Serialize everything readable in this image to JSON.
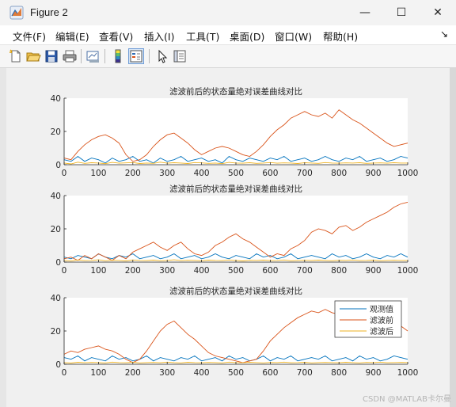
{
  "window": {
    "title": "Figure 2",
    "minimize_glyph": "—",
    "maximize_glyph": "☐",
    "close_glyph": "✕"
  },
  "menu": {
    "items": [
      "文件(F)",
      "编辑(E)",
      "查看(V)",
      "插入(I)",
      "工具(T)",
      "桌面(D)",
      "窗口(W)",
      "帮助(H)"
    ],
    "overflow_glyph": "↘"
  },
  "toolbar": {
    "icons": [
      "new-figure-icon",
      "open-file-icon",
      "save-icon",
      "print-icon",
      "link-plot-icon",
      "insert-colorbar-icon",
      "insert-legend-icon",
      "edit-plot-icon",
      "property-inspector-icon"
    ]
  },
  "watermark": "CSDN @MATLAB卡尔曼",
  "colors": {
    "observed": "#0072BD",
    "before": "#D95319",
    "after": "#EDB120"
  },
  "chart_data": [
    {
      "type": "line",
      "title": "滤波前后的状态量绝对误差曲线对比",
      "xlim": [
        0,
        1000
      ],
      "ylim": [
        0,
        40
      ],
      "xticks": [
        0,
        100,
        200,
        300,
        400,
        500,
        600,
        700,
        800,
        900,
        1000
      ],
      "yticks": [
        0,
        20,
        40
      ],
      "grid": false,
      "x": [
        0,
        20,
        40,
        60,
        80,
        100,
        120,
        140,
        160,
        180,
        200,
        220,
        240,
        260,
        280,
        300,
        320,
        340,
        360,
        380,
        400,
        420,
        440,
        460,
        480,
        500,
        520,
        540,
        560,
        580,
        600,
        620,
        640,
        660,
        680,
        700,
        720,
        740,
        760,
        780,
        800,
        820,
        840,
        860,
        880,
        900,
        920,
        940,
        960,
        980,
        1000
      ],
      "series": [
        {
          "values": [
            3,
            2,
            5,
            2,
            4,
            3,
            1,
            4,
            2,
            3,
            5,
            2,
            3,
            1,
            4,
            2,
            3,
            5,
            2,
            3,
            4,
            2,
            3,
            1,
            5,
            3,
            2,
            4,
            3,
            2,
            4,
            3,
            5,
            2,
            3,
            4,
            2,
            3,
            5,
            3,
            2,
            4,
            3,
            5,
            2,
            3,
            4,
            2,
            3,
            5,
            4
          ]
        },
        {
          "values": [
            4,
            3,
            8,
            12,
            15,
            17,
            18,
            16,
            13,
            6,
            2,
            3,
            6,
            11,
            15,
            18,
            19,
            16,
            13,
            9,
            6,
            8,
            10,
            11,
            10,
            8,
            6,
            5,
            8,
            12,
            17,
            21,
            24,
            28,
            30,
            32,
            30,
            29,
            31,
            28,
            33,
            30,
            27,
            25,
            22,
            19,
            16,
            13,
            11,
            12,
            13
          ]
        },
        {
          "values": [
            1,
            0.5,
            1.5,
            0.8,
            1.2,
            1,
            0.6,
            1.4,
            0.9,
            1.1,
            1.3,
            0.7,
            1,
            0.8,
            1.5,
            0.9,
            1.2,
            1,
            0.7,
            1.3,
            1.1,
            0.8,
            1,
            0.6,
            1.4,
            1,
            0.9,
            1.2,
            0.8,
            1,
            1.3,
            0.9,
            1.1,
            1,
            0.7,
            1.2,
            1,
            0.8,
            1.3,
            1,
            0.9,
            1.1,
            1,
            1.2,
            0.8,
            1,
            1.1,
            0.9,
            1.2,
            1,
            1
          ]
        }
      ]
    },
    {
      "type": "line",
      "title": "滤波前后的状态量绝对误差曲线对比",
      "xlim": [
        0,
        1000
      ],
      "ylim": [
        0,
        40
      ],
      "xticks": [
        0,
        100,
        200,
        300,
        400,
        500,
        600,
        700,
        800,
        900,
        1000
      ],
      "yticks": [
        0,
        20,
        40
      ],
      "grid": false,
      "x": [
        0,
        20,
        40,
        60,
        80,
        100,
        120,
        140,
        160,
        180,
        200,
        220,
        240,
        260,
        280,
        300,
        320,
        340,
        360,
        380,
        400,
        420,
        440,
        460,
        480,
        500,
        520,
        540,
        560,
        580,
        600,
        620,
        640,
        660,
        680,
        700,
        720,
        740,
        760,
        780,
        800,
        820,
        840,
        860,
        880,
        900,
        920,
        940,
        960,
        980,
        1000
      ],
      "series": [
        {
          "values": [
            3,
            2,
            4,
            3,
            2,
            5,
            3,
            2,
            4,
            3,
            5,
            2,
            3,
            4,
            2,
            3,
            5,
            2,
            3,
            4,
            2,
            3,
            5,
            3,
            2,
            4,
            3,
            2,
            5,
            3,
            4,
            2,
            3,
            5,
            2,
            3,
            4,
            3,
            2,
            5,
            3,
            4,
            2,
            3,
            5,
            3,
            2,
            4,
            3,
            5,
            3
          ]
        },
        {
          "values": [
            2,
            3,
            1,
            4,
            2,
            5,
            3,
            1,
            4,
            2,
            6,
            8,
            10,
            12,
            9,
            7,
            10,
            12,
            8,
            5,
            4,
            6,
            10,
            12,
            15,
            17,
            14,
            12,
            9,
            6,
            3,
            5,
            4,
            8,
            10,
            13,
            18,
            20,
            19,
            17,
            21,
            22,
            19,
            21,
            24,
            26,
            28,
            30,
            33,
            35,
            36
          ]
        },
        {
          "values": [
            1,
            0.6,
            1.3,
            0.9,
            1,
            1.4,
            0.8,
            1.1,
            1,
            0.7,
            1.3,
            1,
            0.9,
            1.2,
            0.8,
            1,
            1.4,
            0.9,
            1.1,
            1,
            0.8,
            1.2,
            1,
            0.9,
            1.3,
            1,
            0.7,
            1.1,
            1,
            1.2,
            0.9,
            1,
            1.3,
            0.8,
            1,
            1.1,
            0.9,
            1.2,
            1,
            0.8,
            1.1,
            1,
            1.3,
            0.9,
            1,
            1.2,
            0.8,
            1,
            1.1,
            1,
            1
          ]
        }
      ]
    },
    {
      "type": "line",
      "title": "滤波前后的状态量绝对误差曲线对比",
      "xlim": [
        0,
        1000
      ],
      "ylim": [
        0,
        40
      ],
      "xticks": [
        0,
        100,
        200,
        300,
        400,
        500,
        600,
        700,
        800,
        900,
        1000
      ],
      "yticks": [
        0,
        20,
        40
      ],
      "grid": false,
      "legend": {
        "location": "top-right",
        "entries": [
          "观测值",
          "滤波前",
          "滤波后"
        ]
      },
      "x": [
        0,
        20,
        40,
        60,
        80,
        100,
        120,
        140,
        160,
        180,
        200,
        220,
        240,
        260,
        280,
        300,
        320,
        340,
        360,
        380,
        400,
        420,
        440,
        460,
        480,
        500,
        520,
        540,
        560,
        580,
        600,
        620,
        640,
        660,
        680,
        700,
        720,
        740,
        760,
        780,
        800,
        820,
        840,
        860,
        880,
        900,
        920,
        940,
        960,
        980,
        1000
      ],
      "series": [
        {
          "name": "观测值",
          "values": [
            4,
            3,
            5,
            2,
            4,
            3,
            2,
            5,
            3,
            4,
            2,
            3,
            5,
            2,
            4,
            3,
            2,
            4,
            3,
            5,
            2,
            3,
            4,
            2,
            5,
            3,
            4,
            2,
            3,
            5,
            2,
            4,
            3,
            5,
            2,
            3,
            4,
            3,
            5,
            2,
            3,
            4,
            2,
            5,
            3,
            4,
            2,
            3,
            5,
            4,
            3
          ]
        },
        {
          "name": "滤波前",
          "values": [
            6,
            8,
            7,
            9,
            10,
            11,
            9,
            8,
            6,
            3,
            1,
            3,
            8,
            14,
            20,
            24,
            26,
            22,
            18,
            15,
            11,
            7,
            5,
            4,
            3,
            2,
            1,
            2,
            3,
            8,
            14,
            18,
            22,
            25,
            28,
            30,
            32,
            31,
            33,
            31,
            30,
            28,
            26,
            27,
            29,
            28,
            27,
            26,
            25,
            23,
            20
          ]
        },
        {
          "name": "滤波后",
          "values": [
            1,
            0.7,
            1.2,
            0.9,
            1.1,
            1,
            0.8,
            1.3,
            1,
            0.9,
            1.2,
            0.8,
            1,
            1.1,
            0.9,
            1.3,
            1,
            0.8,
            1.2,
            1,
            0.9,
            1.1,
            1,
            0.8,
            1.3,
            1,
            0.9,
            1.2,
            1,
            0.8,
            1.1,
            1,
            1.3,
            0.9,
            1,
            1.2,
            0.8,
            1,
            1.1,
            1,
            0.9,
            1.2,
            1,
            0.8,
            1.1,
            1,
            1.3,
            0.9,
            1,
            1.1,
            1
          ]
        }
      ]
    }
  ]
}
